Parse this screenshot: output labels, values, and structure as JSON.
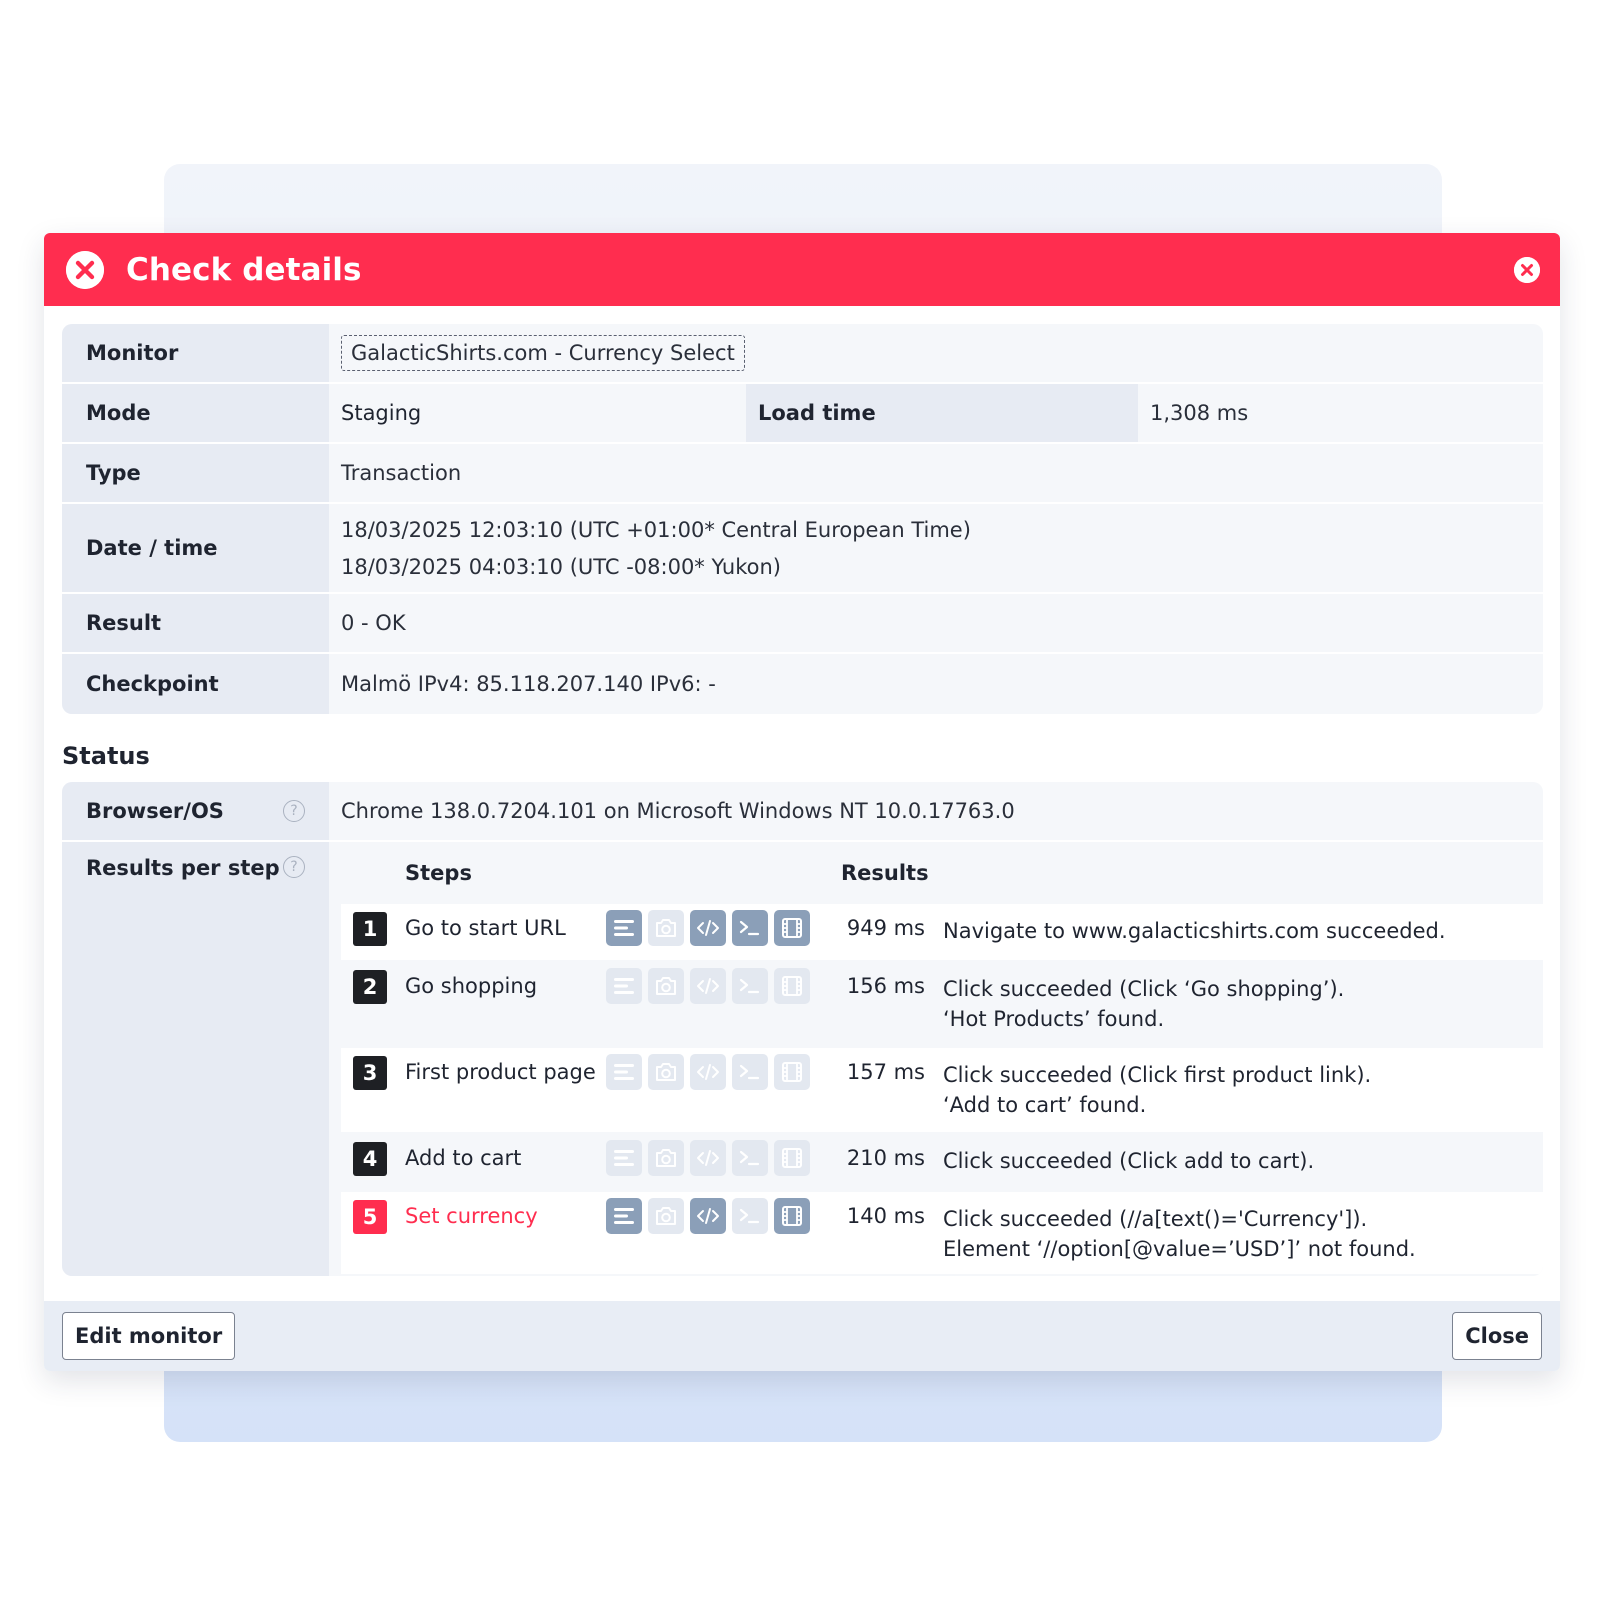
{
  "header": {
    "title": "Check details"
  },
  "details": {
    "monitor_label": "Monitor",
    "monitor_value": "GalacticShirts.com - Currency Select",
    "mode_label": "Mode",
    "mode_value": "Staging",
    "load_time_label": "Load time",
    "load_time_value": "1,308 ms",
    "type_label": "Type",
    "type_value": "Transaction",
    "datetime_label": "Date / time",
    "datetime_line1": "18/03/2025 12:03:10 (UTC +01:00* Central European Time)",
    "datetime_line2": "18/03/2025 04:03:10 (UTC -08:00* Yukon)",
    "result_label": "Result",
    "result_value": "0 - OK",
    "checkpoint_label": "Checkpoint",
    "checkpoint_value": "Malmö IPv4: 85.118.207.140 IPv6: -"
  },
  "status": {
    "title": "Status",
    "browser_label": "Browser/OS",
    "browser_value": "Chrome 138.0.7204.101 on Microsoft Windows NT 10.0.17763.0",
    "results_label": "Results per step",
    "steps_header": "Steps",
    "results_header": "Results",
    "steps": [
      {
        "num": "1",
        "name": "Go to start URL",
        "ms": "949 ms",
        "result": [
          "Navigate to www.galacticshirts.com succeeded."
        ],
        "icons_on": [
          true,
          false,
          true,
          true,
          true
        ],
        "failed": false
      },
      {
        "num": "2",
        "name": "Go shopping",
        "ms": "156 ms",
        "result": [
          "Click succeeded (Click ‘Go shopping’).",
          "‘Hot Products’ found."
        ],
        "icons_on": [
          false,
          false,
          false,
          false,
          false
        ],
        "failed": false
      },
      {
        "num": "3",
        "name": "First product page",
        "ms": "157 ms",
        "result": [
          "Click succeeded (Click first product link).",
          "‘Add to cart’ found."
        ],
        "icons_on": [
          false,
          false,
          false,
          false,
          false
        ],
        "failed": false
      },
      {
        "num": "4",
        "name": "Add to cart",
        "ms": "210 ms",
        "result": [
          "Click succeeded (Click add to cart)."
        ],
        "icons_on": [
          false,
          false,
          false,
          false,
          false
        ],
        "failed": false
      },
      {
        "num": "5",
        "name": "Set currency",
        "ms": "140 ms",
        "result": [
          "Click succeeded (//a[text()='Currency']).",
          "Element ‘//option[@value=’USD’]’ not found."
        ],
        "icons_on": [
          true,
          false,
          true,
          false,
          true
        ],
        "failed": true
      }
    ],
    "icon_names": [
      "log-icon",
      "screenshot-icon",
      "source-code-icon",
      "console-icon",
      "video-icon"
    ]
  },
  "footer": {
    "edit_label": "Edit monitor",
    "close_label": "Close"
  },
  "colors": {
    "accent": "#ff2d4f",
    "icon_active": "#8b9fb8",
    "icon_inactive": "#e3e8f0"
  }
}
